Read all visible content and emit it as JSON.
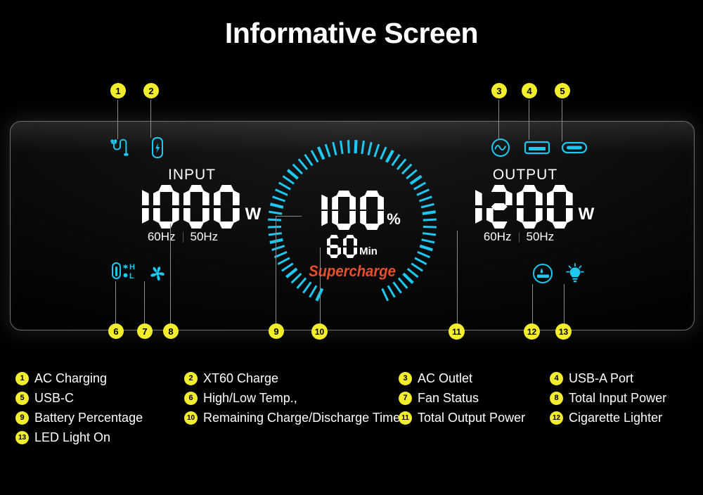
{
  "title": "Informative Screen",
  "colors": {
    "badge_yellow": "#F2EE2E",
    "icon_cyan": "#1EC8F0",
    "supercharge_orange": "#E8502A",
    "panel_border": "#6E6E6E",
    "text_white": "#FFFFFF",
    "background": "#000000"
  },
  "screen": {
    "input": {
      "label": "INPUT",
      "value": "1000",
      "unit": "W",
      "hz_left": "60Hz",
      "hz_right": "50Hz"
    },
    "output": {
      "label": "OUTPUT",
      "value": "1200",
      "unit": "W",
      "hz_left": "60Hz",
      "hz_right": "50Hz"
    },
    "gauge": {
      "percent_value": "100",
      "percent_unit": "%",
      "time_value": "60",
      "time_unit": "Min",
      "status_text": "Supercharge",
      "ticks_total": 60,
      "ticks_active": 60
    },
    "status_icons": [
      {
        "id": "1",
        "name": "ac-charging-icon",
        "position": "top-left"
      },
      {
        "id": "2",
        "name": "xt60-charge-icon",
        "position": "top-left"
      },
      {
        "id": "3",
        "name": "ac-outlet-icon",
        "position": "top-right"
      },
      {
        "id": "4",
        "name": "usb-a-port-icon",
        "position": "top-right"
      },
      {
        "id": "5",
        "name": "usb-c-port-icon",
        "position": "top-right"
      },
      {
        "id": "6",
        "name": "high-low-temp-icon",
        "position": "bottom-left"
      },
      {
        "id": "7",
        "name": "fan-status-icon",
        "position": "bottom-left"
      },
      {
        "id": "12",
        "name": "cigarette-lighter-icon",
        "position": "bottom-right"
      },
      {
        "id": "13",
        "name": "led-light-icon",
        "position": "bottom-right"
      }
    ],
    "temp_labels": {
      "high": "H",
      "low": "L"
    }
  },
  "callouts": [
    {
      "id": "1"
    },
    {
      "id": "2"
    },
    {
      "id": "3"
    },
    {
      "id": "4"
    },
    {
      "id": "5"
    },
    {
      "id": "6"
    },
    {
      "id": "7"
    },
    {
      "id": "8"
    },
    {
      "id": "9"
    },
    {
      "id": "10"
    },
    {
      "id": "11"
    },
    {
      "id": "12"
    },
    {
      "id": "13"
    }
  ],
  "legend": [
    {
      "id": "1",
      "label": "AC Charging"
    },
    {
      "id": "2",
      "label": "XT60 Charge"
    },
    {
      "id": "3",
      "label": "AC Outlet"
    },
    {
      "id": "4",
      "label": "USB-A Port"
    },
    {
      "id": "5",
      "label": "USB-C"
    },
    {
      "id": "6",
      "label": "High/Low Temp.,"
    },
    {
      "id": "7",
      "label": "Fan Status"
    },
    {
      "id": "8",
      "label": "Total Input Power"
    },
    {
      "id": "9",
      "label": "Battery Percentage"
    },
    {
      "id": "10",
      "label": "Remaining Charge/Discharge Time"
    },
    {
      "id": "11",
      "label": "Total Output Power"
    },
    {
      "id": "12",
      "label": "Cigarette Lighter"
    },
    {
      "id": "13",
      "label": "LED Light On"
    }
  ]
}
